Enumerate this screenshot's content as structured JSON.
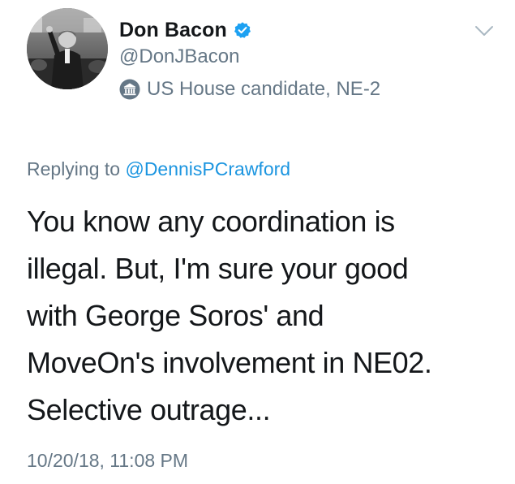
{
  "author": {
    "display_name": "Don Bacon",
    "handle": "@DonJBacon",
    "verified": true,
    "label": "US House candidate, NE-2",
    "label_icon": "government-building-icon",
    "avatar_icon": "profile-photo"
  },
  "menu": {
    "icon": "chevron-down-icon"
  },
  "reply": {
    "prefix": "Replying to",
    "mention": "@DennisPCrawford"
  },
  "tweet": {
    "lines": [
      "You know any coordination is",
      "illegal. But, I'm sure your good",
      "with George Soros' and",
      "MoveOn's involvement in NE02.",
      "Selective outrage..."
    ]
  },
  "timestamp": "10/20/18, 11:08 PM",
  "colors": {
    "text": "#14171a",
    "secondary": "#657786",
    "link": "#1b95e0",
    "verified": "#1da1f2"
  }
}
